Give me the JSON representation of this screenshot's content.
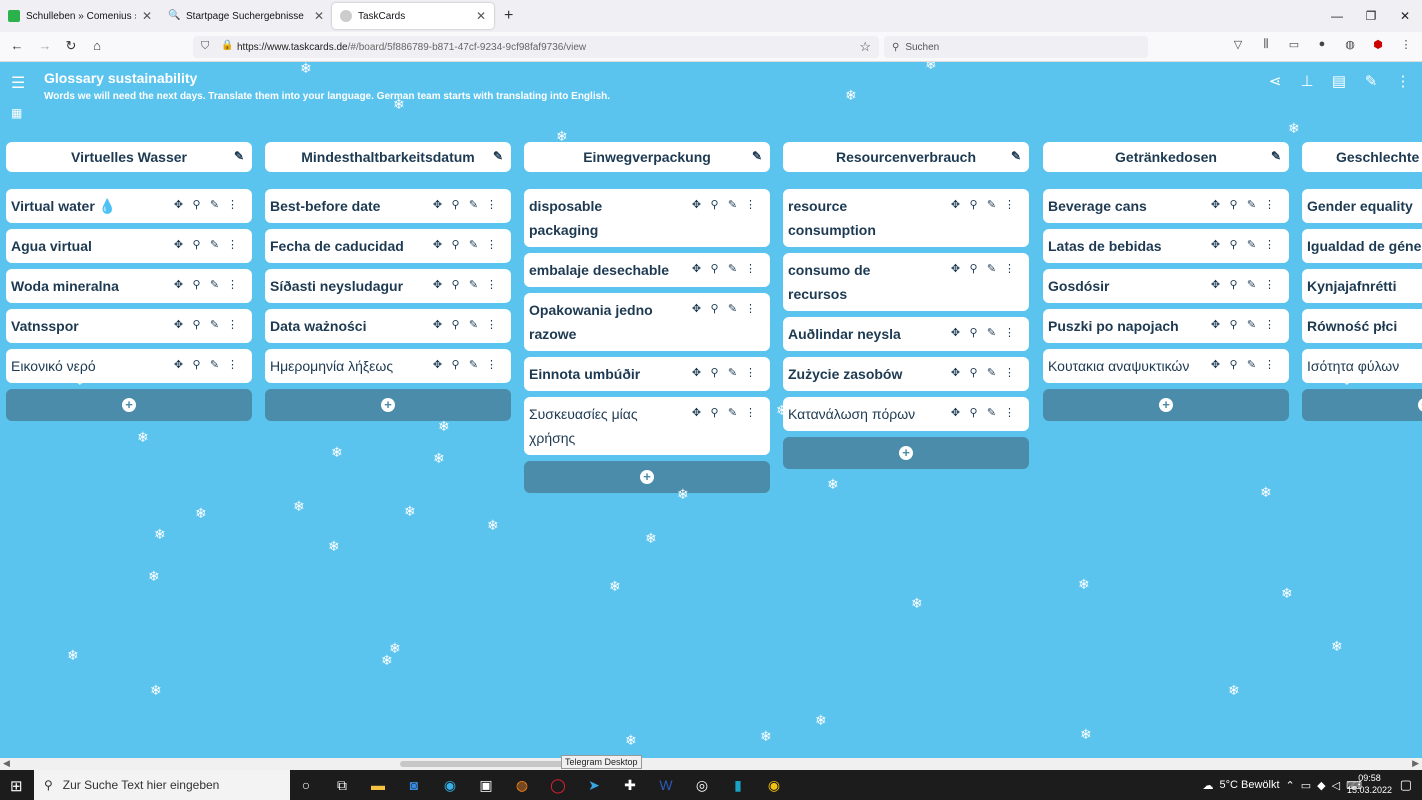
{
  "browser": {
    "tabs": [
      {
        "title": "Schulleben » Comenius » Beitr",
        "active": false,
        "favicon_color": "#2bb24c"
      },
      {
        "title": "Startpage Suchergebnisse",
        "active": false,
        "favicon_color": "#6573ff"
      },
      {
        "title": "TaskCards",
        "active": true,
        "favicon_color": "#cccccc"
      }
    ],
    "new_tab": "+",
    "url_host": "https://www.taskcards.de",
    "url_path": "/#/board/5f886789-b871-47cf-9234-9cf98faf9736/view",
    "search_placeholder": "Suchen"
  },
  "board": {
    "title": "Glossary sustainability",
    "subtitle": "Words we will need the next days. Translate them into your language. German team starts with translating into English."
  },
  "columns": [
    {
      "header": "Virtuelles Wasser",
      "cards": [
        {
          "text": "Virtual water",
          "bold": true,
          "icon": "water-drop"
        },
        {
          "text": "Agua virtual",
          "bold": true
        },
        {
          "text": "Woda mineralna",
          "bold": true
        },
        {
          "text": "Vatnsspor",
          "bold": true
        },
        {
          "text": "Εικονικό νερό",
          "bold": false
        }
      ]
    },
    {
      "header": "Mindesthaltbarkeitsdatum",
      "cards": [
        {
          "text": "Best-before date",
          "bold": true
        },
        {
          "text": "Fecha de caducidad",
          "bold": true
        },
        {
          "text": "Síðasti neysludagur",
          "bold": true
        },
        {
          "text": "Data ważności",
          "bold": true
        },
        {
          "text": "Ημερομηνία λήξεως",
          "bold": false
        }
      ]
    },
    {
      "header": "Einwegverpackung",
      "cards": [
        {
          "text": "disposable packaging",
          "bold": true
        },
        {
          "text": "embalaje desechable",
          "bold": true
        },
        {
          "text": "Opakowania jedno razowe",
          "bold": true
        },
        {
          "text": "Einnota umbúðir",
          "bold": true
        },
        {
          "text": "Συσκευασίες μίας χρήσης",
          "bold": false
        }
      ]
    },
    {
      "header": "Resourcenverbrauch",
      "cards": [
        {
          "text": "resource consumption",
          "bold": true
        },
        {
          "text": "consumo de recursos",
          "bold": true
        },
        {
          "text": "Auðlindar neysla",
          "bold": true
        },
        {
          "text": "Zużycie zasobów",
          "bold": true
        },
        {
          "text": "Κατανάλωση πόρων",
          "bold": false
        }
      ]
    },
    {
      "header": "Getränkedosen",
      "cards": [
        {
          "text": "Beverage cans",
          "bold": true
        },
        {
          "text": "Latas de bebidas",
          "bold": true
        },
        {
          "text": "Gosdósir",
          "bold": true
        },
        {
          "text": "Puszki po napojach",
          "bold": true
        },
        {
          "text": "Κουτακια αναψυκτικών",
          "bold": false
        }
      ]
    },
    {
      "header": "Geschlechte",
      "cards": [
        {
          "text": "Gender equality",
          "bold": true
        },
        {
          "text": "Igualdad de géne",
          "bold": true
        },
        {
          "text": "Kynjajafnrétti",
          "bold": true
        },
        {
          "text": "Równość płci",
          "bold": true
        },
        {
          "text": "Ισότητα φύλων",
          "bold": false
        }
      ]
    }
  ],
  "tooltip": "Telegram Desktop",
  "taskbar": {
    "search_placeholder": "Zur Suche Text hier eingeben",
    "weather": "5°C  Bewölkt",
    "time": "09:58",
    "date": "15.03.2022"
  },
  "colors": {
    "page_bg": "#5bc4ee",
    "add_button": "#4a8caa",
    "text": "#1d3a52"
  }
}
